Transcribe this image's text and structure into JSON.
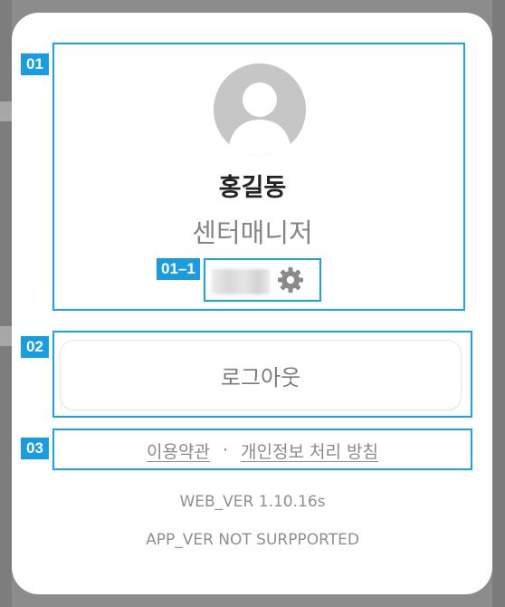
{
  "profile": {
    "name": "홍길동",
    "role": "센터매니저",
    "avatar_icon": "user-silhouette-icon",
    "settings_icon": "gear-icon"
  },
  "annotations": {
    "tag_01": "01",
    "tag_01_1": "01–1",
    "tag_02": "02",
    "tag_03": "03",
    "color": "#1a9de0"
  },
  "logout": {
    "label": "로그아웃"
  },
  "links": {
    "terms": "이용약관",
    "separator": "·",
    "privacy": "개인정보 처리 방침"
  },
  "version": {
    "web": "WEB_VER 1.10.16s",
    "app": "APP_VER NOT SURPPORTED"
  }
}
